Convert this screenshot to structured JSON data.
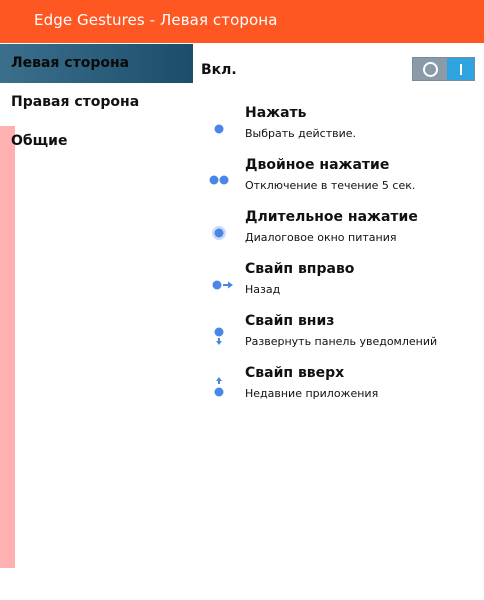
{
  "header": {
    "title": "Edge Gestures - Левая сторона"
  },
  "colors": {
    "accent": "#ff5722",
    "sidebar_active": "#1f5474",
    "toggle_on": "#2fa3e0",
    "gesture_icon": "#4a86e8",
    "strip": "#ffb0b0"
  },
  "sidebar": {
    "items": [
      {
        "label": "Левая сторона",
        "active": true
      },
      {
        "label": "Правая сторона",
        "active": false
      },
      {
        "label": "Общие",
        "active": false
      }
    ]
  },
  "main": {
    "enable_label": "Вкл.",
    "toggle_on": true,
    "gestures": [
      {
        "title": "Нажать",
        "subtitle": "Выбрать действие.",
        "icon": "tap-icon"
      },
      {
        "title": "Двойное нажатие",
        "subtitle": "Отключение в течение 5 сек.",
        "icon": "double-tap-icon"
      },
      {
        "title": "Длительное нажатие",
        "subtitle": "Диалоговое окно питания",
        "icon": "long-press-icon"
      },
      {
        "title": "Свайп вправо",
        "subtitle": "Назад",
        "icon": "swipe-right-icon"
      },
      {
        "title": "Свайп вниз",
        "subtitle": "Развернуть панель уведомлений",
        "icon": "swipe-down-icon"
      },
      {
        "title": "Свайп вверх",
        "subtitle": "Недавние приложения",
        "icon": "swipe-up-icon"
      }
    ]
  }
}
